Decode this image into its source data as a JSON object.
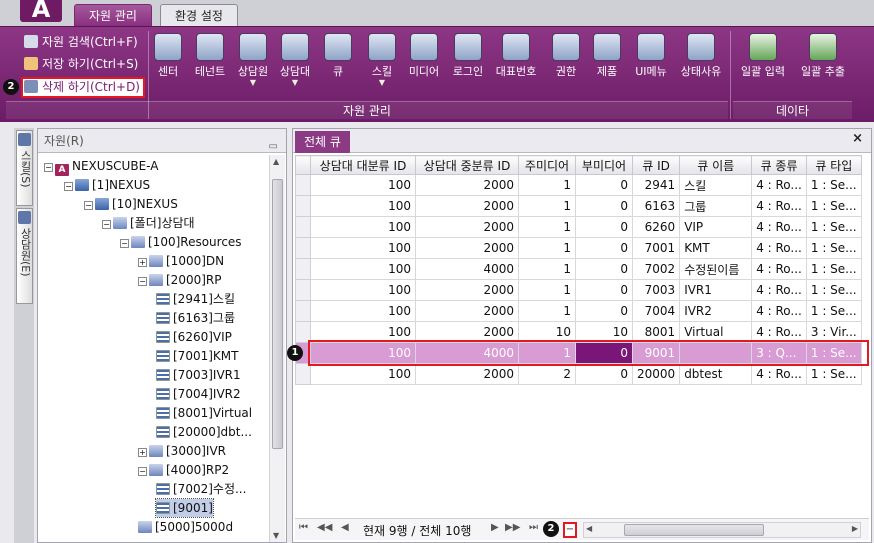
{
  "app": {
    "logo_letter": "A"
  },
  "top_tabs": [
    {
      "label": "자원 관리"
    },
    {
      "label": "환경 설정"
    }
  ],
  "ribbon": {
    "commands": {
      "search": "자원 검색(Ctrl+F)",
      "save": "저장 하기(Ctrl+S)",
      "delete": "삭제 하기(Ctrl+D)"
    },
    "buttons": [
      {
        "label": "센터",
        "dropdown": false
      },
      {
        "label": "테넌트",
        "dropdown": false
      },
      {
        "label": "상담원",
        "dropdown": true
      },
      {
        "label": "상담대",
        "dropdown": true
      },
      {
        "label": "큐",
        "dropdown": false
      },
      {
        "label": "스킬",
        "dropdown": true
      },
      {
        "label": "미디어",
        "dropdown": false
      },
      {
        "label": "로그인",
        "dropdown": false
      },
      {
        "label": "대표번호",
        "dropdown": false
      },
      {
        "label": "권한",
        "dropdown": false
      },
      {
        "label": "제품",
        "dropdown": false
      },
      {
        "label": "UI메뉴",
        "dropdown": false
      },
      {
        "label": "상태사유",
        "dropdown": false
      },
      {
        "label": "일괄 입력",
        "dropdown": false
      },
      {
        "label": "일괄 추출",
        "dropdown": false
      }
    ],
    "group_resource": "자원 관리",
    "group_data": "데이타"
  },
  "callouts": {
    "one": "1",
    "two": "2"
  },
  "side_tabs": [
    {
      "label": "스킬(S)"
    },
    {
      "label": "상담원(E)"
    }
  ],
  "tree": {
    "header": "자원(R)",
    "nodes": [
      {
        "label": "NEXUSCUBE-A",
        "icon": "root-icon"
      },
      {
        "label": "[1]NEXUS",
        "icon": "database-icon"
      },
      {
        "label": "[10]NEXUS",
        "icon": "database-icon"
      },
      {
        "label": "[폴더]상담대",
        "icon": "group-icon"
      },
      {
        "label": "[100]Resources",
        "icon": "group-icon"
      },
      {
        "label": "[1000]DN",
        "icon": "group-icon"
      },
      {
        "label": "[2000]RP",
        "icon": "group-icon"
      },
      {
        "label": "[2941]스킬",
        "icon": "queue-icon"
      },
      {
        "label": "[6163]그룹",
        "icon": "queue-icon"
      },
      {
        "label": "[6260]VIP",
        "icon": "queue-icon"
      },
      {
        "label": "[7001]KMT",
        "icon": "queue-icon"
      },
      {
        "label": "[7003]IVR1",
        "icon": "queue-icon"
      },
      {
        "label": "[7004]IVR2",
        "icon": "queue-icon"
      },
      {
        "label": "[8001]Virtual",
        "icon": "queue-icon"
      },
      {
        "label": "[20000]dbt...",
        "icon": "queue-icon"
      },
      {
        "label": "[3000]IVR",
        "icon": "group-icon"
      },
      {
        "label": "[4000]RP2",
        "icon": "group-icon"
      },
      {
        "label": "[7002]수정...",
        "icon": "queue-icon"
      },
      {
        "label": "[9001]",
        "icon": "queue-icon",
        "selected": true
      },
      {
        "label": "[5000]5000d",
        "icon": "group-icon"
      }
    ]
  },
  "grid": {
    "tab_label": "전체 큐",
    "close_glyph": "×",
    "columns": [
      "상담대 대분류 ID",
      "상담대 중분류 ID",
      "주미디어",
      "부미디어",
      "큐 ID",
      "큐 이름",
      "큐 종류",
      "큐 타입"
    ],
    "rows": [
      [
        "100",
        "2000",
        "1",
        "0",
        "2941",
        "스킬",
        "4 : Ro...",
        "1 : Se..."
      ],
      [
        "100",
        "2000",
        "1",
        "0",
        "6163",
        "그룹",
        "4 : Ro...",
        "1 : Se..."
      ],
      [
        "100",
        "2000",
        "1",
        "0",
        "6260",
        "VIP",
        "4 : Ro...",
        "1 : Se..."
      ],
      [
        "100",
        "2000",
        "1",
        "0",
        "7001",
        "KMT",
        "4 : Ro...",
        "1 : Se..."
      ],
      [
        "100",
        "4000",
        "1",
        "0",
        "7002",
        "수정된이름",
        "4 : Ro...",
        "1 : Se..."
      ],
      [
        "100",
        "2000",
        "1",
        "0",
        "7003",
        "IVR1",
        "4 : Ro...",
        "1 : Se..."
      ],
      [
        "100",
        "2000",
        "1",
        "0",
        "7004",
        "IVR2",
        "4 : Ro...",
        "1 : Se..."
      ],
      [
        "100",
        "2000",
        "10",
        "10",
        "8001",
        "Virtual",
        "4 : Ro...",
        "3 : Vir..."
      ],
      [
        "100",
        "4000",
        "1",
        "0",
        "9001",
        "",
        "3 : Q...",
        "1 : Se..."
      ],
      [
        "100",
        "2000",
        "2",
        "0",
        "20000",
        "dbtest",
        "4 : Ro...",
        "1 : Se..."
      ]
    ],
    "selected_row_index": 8,
    "nav_text": "현재 9행 / 전체 10행",
    "delete_glyph": "−"
  }
}
